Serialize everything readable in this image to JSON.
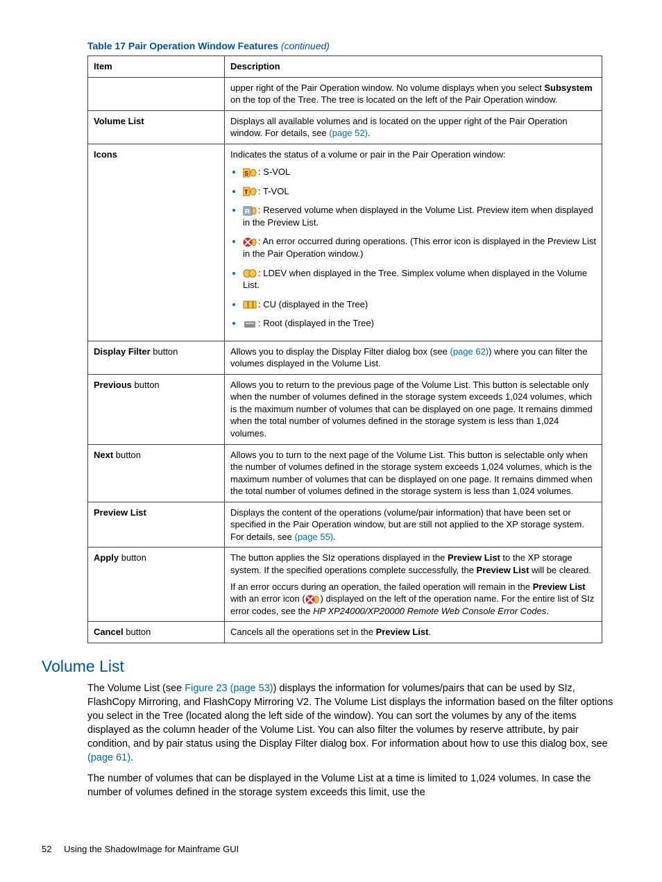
{
  "caption": {
    "main": "Table 17 Pair Operation Window Features",
    "cont": "(continued)"
  },
  "columns": {
    "item": "Item",
    "desc": "Description"
  },
  "rows": {
    "firstDesc": {
      "pre": "upper right of the Pair Operation window. No volume displays when you select ",
      "bold": "Subsystem",
      "post": " on the top of the Tree. The tree is located on the left of the Pair Operation window."
    },
    "vol": {
      "item": "Volume List",
      "pre": "Displays all available volumes and is located on the upper right of the Pair Operation window. For details, see ",
      "link": "(page 52)",
      "post": "."
    },
    "icons": {
      "item": "Icons",
      "lead": "Indicates the status of a volume or pair in the Pair Operation window:",
      "svol": ": S-VOL",
      "tvol": ": T-VOL",
      "reserved": ": Reserved volume when displayed in the Volume List. Preview item when displayed in the Preview List.",
      "error": ": An error occurred during operations. (This error icon is displayed in the Preview List in the Pair Operation window.)",
      "ldev": ": LDEV when displayed in the Tree. Simplex volume when displayed in the Volume List.",
      "cu": ": CU (displayed in the Tree)",
      "root": ": Root (displayed in the Tree)"
    },
    "dfilter": {
      "itemBold": "Display Filter",
      "itemNorm": " button",
      "pre": "Allows you to display the Display Filter dialog box (see ",
      "link": "(page 62)",
      "post": ") where you can filter the volumes displayed in the Volume List."
    },
    "prev": {
      "itemBold": "Previous",
      "itemNorm": " button",
      "desc": "Allows you to return to the previous page of the Volume List. This button is selectable only when the number of volumes defined in the storage system exceeds 1,024 volumes, which is the maximum number of volumes that can be displayed on one page. It remains dimmed when the total number of volumes defined in the storage system is less than 1,024 volumes."
    },
    "next": {
      "itemBold": "Next",
      "itemNorm": " button",
      "desc": "Allows you to turn to the next page of the Volume List. This button is selectable only when the number of volumes defined in the storage system exceeds 1,024 volumes, which is the maximum number of volumes that can be displayed on one page. It remains dimmed when the total number of volumes defined in the storage system is less than 1,024 volumes."
    },
    "plist": {
      "item": "Preview List",
      "pre": "Displays the content of the operations (volume/pair information) that have been set or specified in the Pair Operation window, but are still not applied to the XP storage system. For details, see ",
      "link": "(page 55)",
      "post": "."
    },
    "apply": {
      "itemBold": "Apply",
      "itemNorm": " button",
      "p1a": "The button applies the SIz operations displayed in the ",
      "p1b": "Preview List",
      "p1c": " to the XP storage system. If the specified operations complete successfully, the ",
      "p1d": "Preview List",
      "p1e": " will be cleared.",
      "p2a": "If an error occurs during an operation, the failed operation will remain in the ",
      "p2b": "Preview List",
      "p2c": " with an error icon (",
      "p2d": ") displayed on the left of the operation name. For the entire list of SIz error codes, see the ",
      "p2e": "HP XP24000/XP20000 Remote Web Console Error Codes",
      "p2f": "."
    },
    "cancel": {
      "itemBold": "Cancel",
      "itemNorm": " button",
      "pre": "Cancels all the operations set in the ",
      "bold": "Preview List",
      "post": "."
    }
  },
  "section": {
    "heading": "Volume List",
    "p1a": "The Volume List (see ",
    "p1link": "Figure 23 (page 53)",
    "p1b": ") displays the information for volumes/pairs that can be used by SIz, FlashCopy Mirroring, and FlashCopy Mirroring V2. The Volume List displays the information based on the filter options you select in the Tree (located along the left side of the window). You can sort the volumes by any of the items displayed as the column header of the Volume List. You can also filter the volumes by reserve attribute, by pair condition, and by pair status using the Display Filter dialog box. For information about how to use this dialog box, see ",
    "p1link2": "(page 61)",
    "p1c": ".",
    "p2": "The number of volumes that can be displayed in the Volume List at a time is limited to 1,024 volumes. In case the number of volumes defined in the storage system exceeds this limit, use the"
  },
  "footer": {
    "page": "52",
    "title": "Using the ShadowImage for Mainframe GUI"
  }
}
